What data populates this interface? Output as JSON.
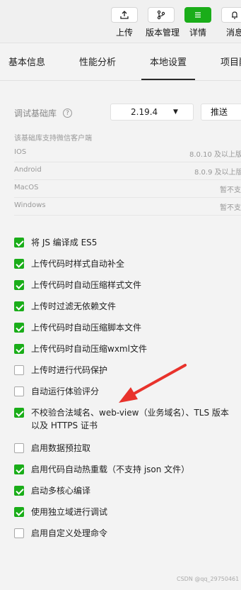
{
  "toolbar": {
    "buttons": [
      {
        "label": "上传",
        "icon": "upload-icon",
        "active": false
      },
      {
        "label": "版本管理",
        "icon": "branch-icon",
        "active": false
      },
      {
        "label": "详情",
        "icon": "menu-icon",
        "active": true
      },
      {
        "label": "消息",
        "icon": "bell-icon",
        "active": false
      }
    ],
    "accent": "#1aad19"
  },
  "tabs": [
    {
      "label": "基本信息",
      "active": false
    },
    {
      "label": "性能分析",
      "active": false
    },
    {
      "label": "本地设置",
      "active": true
    },
    {
      "label": "项目配",
      "active": false
    }
  ],
  "base_lib": {
    "label": "调试基础库",
    "help_icon": "question-circle-icon",
    "selected_version": "2.19.4",
    "dropdown_icon": "caret-down-icon",
    "push_label": "推送"
  },
  "support": {
    "title": "该基础库支持微信客户端",
    "rows": [
      {
        "os": "IOS",
        "version": "8.0.10 及以上版"
      },
      {
        "os": "Android",
        "version": "8.0.9 及以上版"
      },
      {
        "os": "MacOS",
        "version": "暂不支"
      },
      {
        "os": "Windows",
        "version": "暂不支"
      }
    ]
  },
  "options": [
    {
      "label": "将 JS 编译成 ES5",
      "checked": true
    },
    {
      "label": "上传代码时样式自动补全",
      "checked": true
    },
    {
      "label": "上传代码时自动压缩样式文件",
      "checked": true
    },
    {
      "label": "上传时过滤无依赖文件",
      "checked": true
    },
    {
      "label": "上传代码时自动压缩脚本文件",
      "checked": true
    },
    {
      "label": "上传代码时自动压缩wxml文件",
      "checked": true
    },
    {
      "label": "上传时进行代码保护",
      "checked": false
    },
    {
      "label": "自动运行体验评分",
      "checked": false
    },
    {
      "label": "不校验合法域名、web-view（业务域名）、TLS 版本以及 HTTPS 证书",
      "checked": true
    },
    {
      "label": "启用数据预拉取",
      "checked": false
    },
    {
      "label": "启用代码自动热重载（不支持 json 文件）",
      "checked": true
    },
    {
      "label": "启动多核心编译",
      "checked": true
    },
    {
      "label": "使用独立域进行调试",
      "checked": true
    },
    {
      "label": "启用自定义处理命令",
      "checked": false
    }
  ],
  "annotation_arrow_color": "#e8322b",
  "watermark": "CSDN @qq_29750461"
}
